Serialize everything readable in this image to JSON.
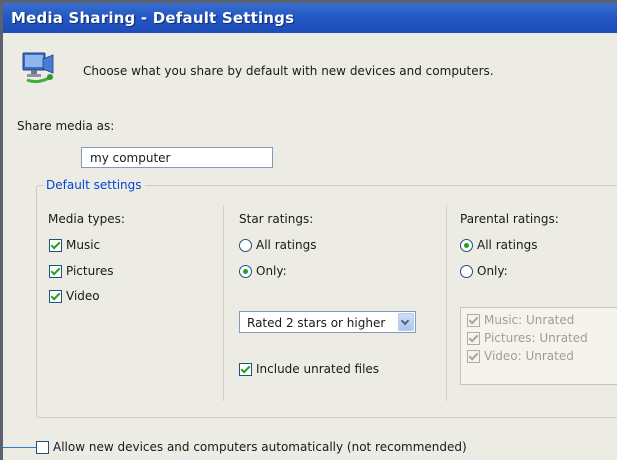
{
  "window": {
    "title": "Media Sharing - Default Settings"
  },
  "intro": {
    "text": "Choose what you share by default with new devices and computers.",
    "icon": "media-sharing-icon"
  },
  "share_media": {
    "label": "Share media as:",
    "value": "my computer"
  },
  "default_settings": {
    "legend": "Default settings",
    "media_types": {
      "label": "Media types:",
      "items": [
        {
          "label": "Music",
          "checked": true
        },
        {
          "label": "Pictures",
          "checked": true
        },
        {
          "label": "Video",
          "checked": true
        }
      ]
    },
    "star_ratings": {
      "label": "Star ratings:",
      "options": [
        {
          "label": "All ratings",
          "selected": false
        },
        {
          "label": "Only:",
          "selected": true
        }
      ],
      "dropdown_value": "Rated 2 stars or higher",
      "include_unrated": {
        "label": "Include unrated files",
        "checked": true
      }
    },
    "parental_ratings": {
      "label": "Parental ratings:",
      "options": [
        {
          "label": "All ratings",
          "selected": true
        },
        {
          "label": "Only:",
          "selected": false
        }
      ],
      "list_items": [
        {
          "label": "Music: Unrated",
          "checked": true
        },
        {
          "label": "Pictures: Unrated",
          "checked": true
        },
        {
          "label": "Video: Unrated",
          "checked": true
        }
      ]
    }
  },
  "allow_auto": {
    "label": "Allow new devices and computers automatically (not recommended)",
    "checked": false
  },
  "colors": {
    "titlebar": "#2458c4",
    "legend": "#0046d5",
    "check": "#21a121"
  }
}
